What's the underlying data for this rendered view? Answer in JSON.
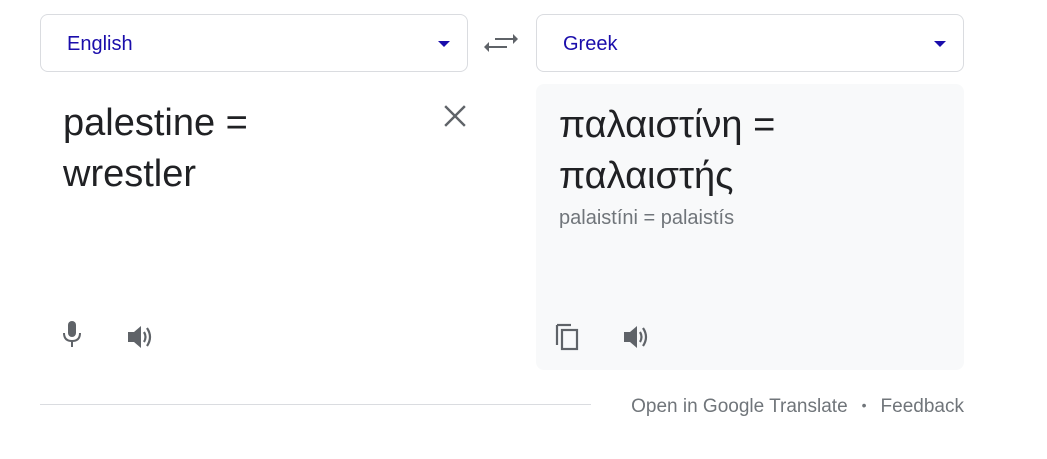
{
  "source_language": {
    "label": "English"
  },
  "target_language": {
    "label": "Greek"
  },
  "source_text": {
    "line1": "palestine =",
    "line2": "wrestler"
  },
  "target_text": {
    "line1": "παλαιστίνη =",
    "line2": "παλαιστής",
    "transliteration": "palaistíni = palaistís"
  },
  "icons": {
    "source_dropdown": "chevron-down-icon",
    "target_dropdown": "chevron-down-icon",
    "swap": "swap-languages-icon",
    "clear": "close-icon",
    "microphone": "microphone-icon",
    "source_speaker": "speaker-icon",
    "copy": "copy-icon",
    "target_speaker": "speaker-icon"
  },
  "footer": {
    "open_link": "Open in Google Translate",
    "separator": "•",
    "feedback_link": "Feedback"
  },
  "colors": {
    "link_blue": "#1a0dab",
    "icon_gray": "#5f6368",
    "muted_text": "#70757a",
    "panel_bg": "#f8f9fa",
    "border": "#dadce0"
  }
}
